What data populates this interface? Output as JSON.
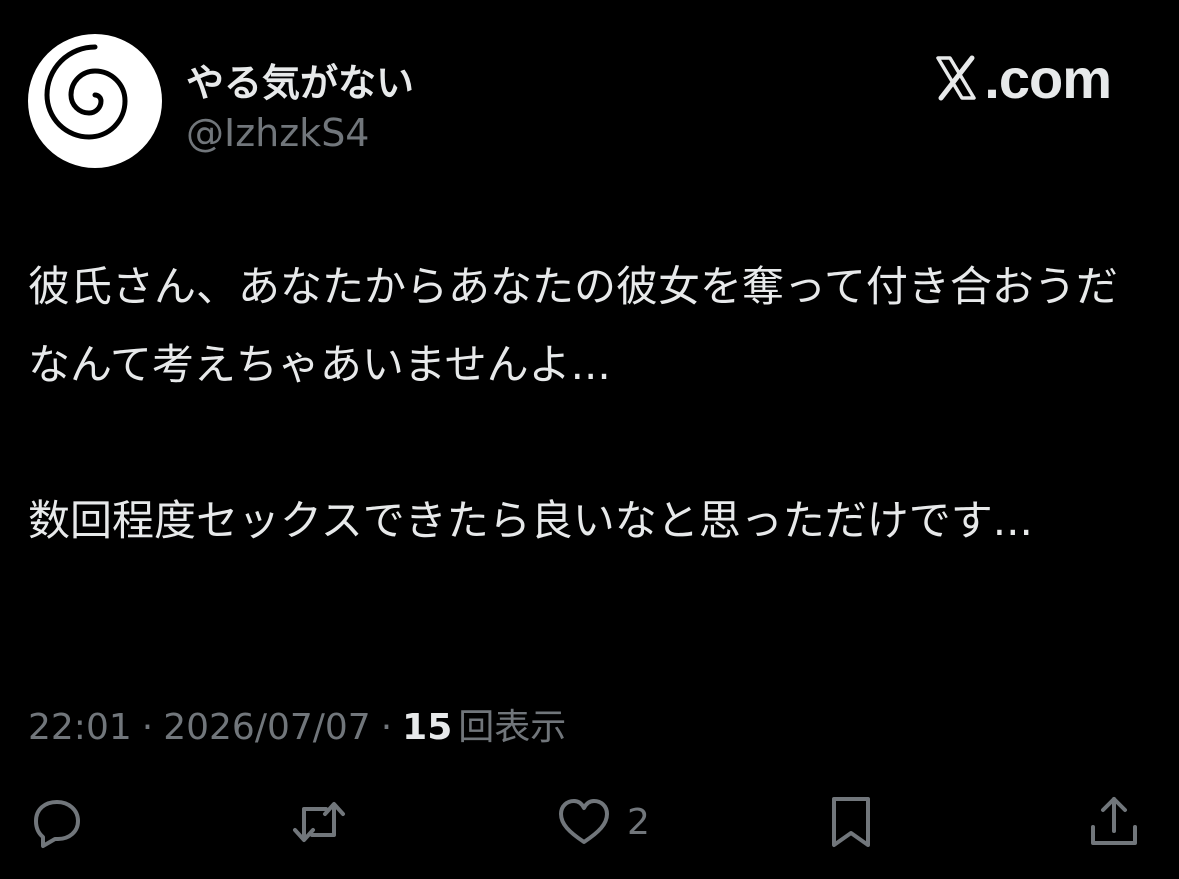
{
  "author": {
    "display_name": "やる気がない",
    "handle": "@IzhzkS4"
  },
  "brand": {
    "text": ".com",
    "icon": "x-logo-icon"
  },
  "tweet": {
    "text": "彼氏さん、あなたからあなたの彼女を奪って付き合おうだなんて考えちゃあいませんよ...\n\n数回程度セックスできたら良いなと思っただけです..."
  },
  "meta": {
    "time": "22:01",
    "separator": "·",
    "date": "2026/07/07",
    "views_count": "15",
    "views_label": "回表示"
  },
  "actions": {
    "reply": {
      "icon": "reply-icon"
    },
    "repost": {
      "icon": "repost-icon"
    },
    "like": {
      "icon": "heart-icon",
      "count": "2"
    },
    "bookmark": {
      "icon": "bookmark-icon"
    },
    "share": {
      "icon": "share-icon"
    }
  },
  "colors": {
    "background": "#000000",
    "primary_text": "#e7e9ea",
    "secondary_text": "#71767b"
  }
}
